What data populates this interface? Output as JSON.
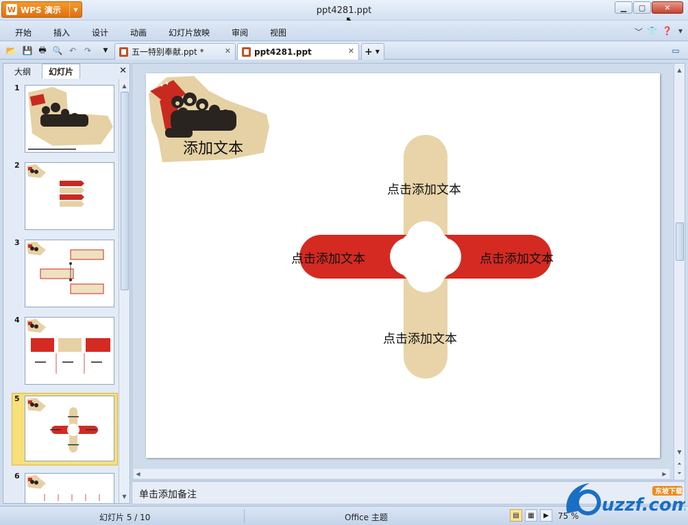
{
  "app": {
    "button_label": "WPS 演示",
    "logo_letter": "W",
    "window_title": "ppt4281.ppt"
  },
  "window_controls": [
    "minimize",
    "maximize",
    "close"
  ],
  "menu": {
    "items": [
      "开始",
      "插入",
      "设计",
      "动画",
      "幻灯片放映",
      "审阅",
      "视图"
    ]
  },
  "quick_toolbar": [
    "open-icon",
    "save-icon",
    "print-icon",
    "print-preview-icon",
    "undo-icon",
    "redo-icon",
    "customize-icon"
  ],
  "doc_tabs": [
    {
      "label": "五一特别奉献.ppt *",
      "active": false
    },
    {
      "label": "ppt4281.ppt",
      "active": true
    }
  ],
  "left_panel": {
    "tabs": [
      "大纲",
      "幻灯片"
    ],
    "active_tab": "幻灯片",
    "thumbnails": [
      {
        "number": "1",
        "selected": false
      },
      {
        "number": "2",
        "selected": false
      },
      {
        "number": "3",
        "selected": false
      },
      {
        "number": "4",
        "selected": false
      },
      {
        "number": "5",
        "selected": true
      },
      {
        "number": "6",
        "selected": false
      }
    ]
  },
  "slide": {
    "title": "添加文本",
    "top_text": "点击添加文本",
    "left_text": "点击添加文本",
    "right_text": "点击添加文本",
    "bottom_text": "点击添加文本",
    "colors": {
      "red": "#d42a22",
      "tan": "#e8d4a8"
    }
  },
  "notes": {
    "placeholder": "单击添加备注"
  },
  "status": {
    "slide_counter": "幻灯片 5 / 10",
    "theme": "Office 主题",
    "zoom": "75 %"
  },
  "watermark": {
    "text": "uzzf.com",
    "tag": "东坡下载"
  }
}
